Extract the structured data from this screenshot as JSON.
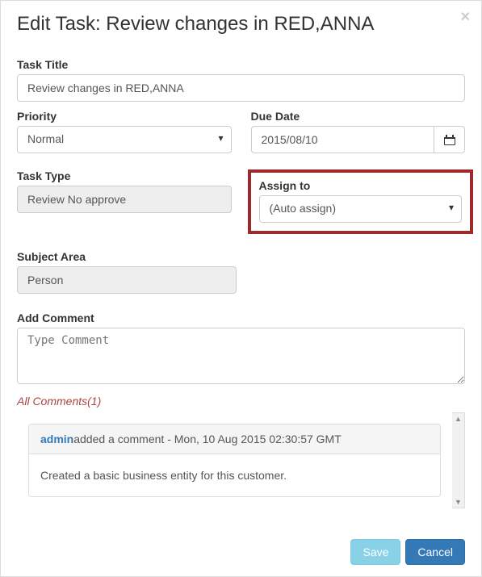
{
  "modal": {
    "title": "Edit Task: Review changes in RED,ANNA"
  },
  "fields": {
    "taskTitle": {
      "label": "Task Title",
      "value": "Review changes in RED,ANNA"
    },
    "priority": {
      "label": "Priority",
      "value": "Normal"
    },
    "dueDate": {
      "label": "Due Date",
      "value": "2015/08/10"
    },
    "taskType": {
      "label": "Task Type",
      "value": "Review No approve"
    },
    "assignTo": {
      "label": "Assign to",
      "value": "(Auto assign)"
    },
    "subject": {
      "label": "Subject Area",
      "value": "Person"
    },
    "addComment": {
      "label": "Add Comment",
      "placeholder": "Type Comment"
    }
  },
  "comments": {
    "header": "All Comments(1)",
    "items": [
      {
        "user": "admin",
        "meta": "added a comment - Mon, 10 Aug 2015 02:30:57 GMT",
        "body": "Created a basic business entity for this customer."
      }
    ]
  },
  "buttons": {
    "save": "Save",
    "cancel": "Cancel"
  }
}
